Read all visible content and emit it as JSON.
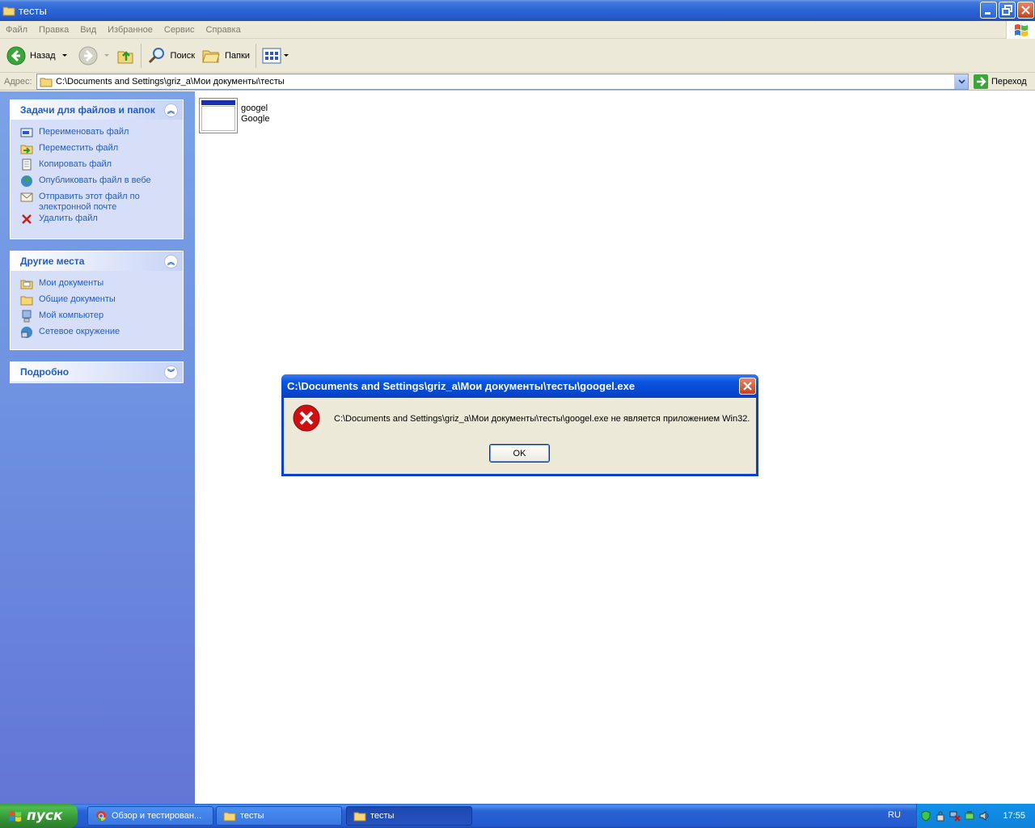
{
  "window": {
    "title": "тесты"
  },
  "menu": [
    "Файл",
    "Правка",
    "Вид",
    "Избранное",
    "Сервис",
    "Справка"
  ],
  "toolbar": {
    "back_label": "Назад",
    "search_label": "Поиск",
    "folders_label": "Папки"
  },
  "address": {
    "label": "Адрес:",
    "path": "C:\\Documents and Settings\\griz_a\\Мои документы\\тесты",
    "go_label": "Переход"
  },
  "tasks_panel": {
    "title": "Задачи для файлов и папок",
    "items": [
      {
        "label": "Переименовать файл",
        "icon": "rename-icon"
      },
      {
        "label": "Переместить файл",
        "icon": "move-icon"
      },
      {
        "label": "Копировать файл",
        "icon": "copy-icon"
      },
      {
        "label": "Опубликовать файл в вебе",
        "icon": "globe-icon"
      },
      {
        "label": "Отправить этот файл по электронной почте",
        "icon": "email-icon"
      },
      {
        "label": "Удалить файл",
        "icon": "delete-icon"
      }
    ]
  },
  "places_panel": {
    "title": "Другие места",
    "items": [
      {
        "label": "Мои документы",
        "icon": "my-documents-icon"
      },
      {
        "label": "Общие документы",
        "icon": "folder-icon"
      },
      {
        "label": "Мой компьютер",
        "icon": "computer-icon"
      },
      {
        "label": "Сетевое окружение",
        "icon": "network-icon"
      }
    ]
  },
  "details_panel": {
    "title": "Подробно"
  },
  "file": {
    "name": "googel",
    "description": "Google"
  },
  "dialog": {
    "title": "C:\\Documents and Settings\\griz_a\\Мои документы\\тесты\\googel.exe",
    "message": "C:\\Documents and Settings\\griz_a\\Мои документы\\тесты\\googel.exe не является приложением Win32.",
    "ok_label": "OK"
  },
  "taskbar": {
    "start_label": "пуск",
    "tasks": [
      {
        "label": "Обзор и тестирован...",
        "icon": "chrome-icon"
      },
      {
        "label": "тесты",
        "icon": "folder-icon"
      },
      {
        "label": "тесты",
        "icon": "folder-icon"
      }
    ],
    "lang": "RU",
    "clock": "17:55"
  },
  "colors": {
    "titlebar": "#2a64d6",
    "link": "#215dc6",
    "error": "#d01010"
  }
}
